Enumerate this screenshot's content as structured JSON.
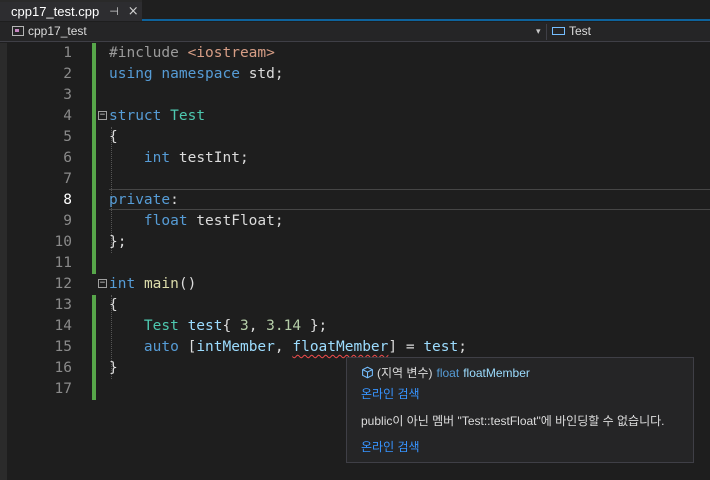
{
  "tab": {
    "title": "cpp17_test.cpp",
    "pin_icon": "⊣",
    "close_icon": "×"
  },
  "navbar": {
    "project": "cpp17_test",
    "dropdown_icon": "▾",
    "scope": "Test"
  },
  "editor": {
    "line_numbers": [
      "1",
      "2",
      "3",
      "4",
      "5",
      "6",
      "7",
      "8",
      "9",
      "10",
      "11",
      "12",
      "13",
      "14",
      "15",
      "16",
      "17"
    ],
    "current_line": "8",
    "lines": [
      "#include <iostream>",
      "using namespace std;",
      "",
      "struct Test",
      "{",
      "    int testInt;",
      "",
      "private:",
      "    float testFloat;",
      "};",
      "",
      "int main()",
      "{",
      "    Test test{ 3, 3.14 };",
      "    auto [intMember, floatMember] = test;",
      "}",
      ""
    ]
  },
  "tokens": {
    "l1": [
      "#include",
      " ",
      "<iostream>"
    ],
    "l2": [
      "using",
      " ",
      "namespace",
      " std;"
    ],
    "l4": [
      "struct",
      " ",
      "Test"
    ],
    "l5": [
      "{"
    ],
    "l6": [
      "    ",
      "int",
      " testInt;"
    ],
    "l8": [
      "private",
      ":"
    ],
    "l9": [
      "    ",
      "float",
      " testFloat;"
    ],
    "l10": [
      "};"
    ],
    "l12": [
      "int",
      " ",
      "main",
      "()"
    ],
    "l13": [
      "{"
    ],
    "l14": [
      "    ",
      "Test",
      " ",
      "test",
      "{ ",
      "3",
      ", ",
      "3.14",
      " };"
    ],
    "l15": [
      "    ",
      "auto",
      " [",
      "intMember",
      ", ",
      "floatMember",
      "] = ",
      "test",
      ";"
    ],
    "l16": [
      "}"
    ]
  },
  "quickinfo": {
    "scope": "(지역 변수)",
    "type": "float",
    "name": "floatMember",
    "link1": "온라인 검색",
    "message": "public이 아닌 멤버 \"Test::testFloat\"에 바인딩할 수 없습니다.",
    "link2": "온라인 검색",
    "icon": "variable-cube-icon"
  },
  "colors": {
    "accent": "#0e639c",
    "keyword": "#569cd6",
    "type": "#4ec9b0",
    "string": "#d69d85",
    "number": "#b5cea8",
    "function": "#dcdcaa",
    "variable": "#9cdcfe",
    "change_bar": "#57a64a",
    "link": "#3794ff",
    "error": "#f14c4c"
  }
}
